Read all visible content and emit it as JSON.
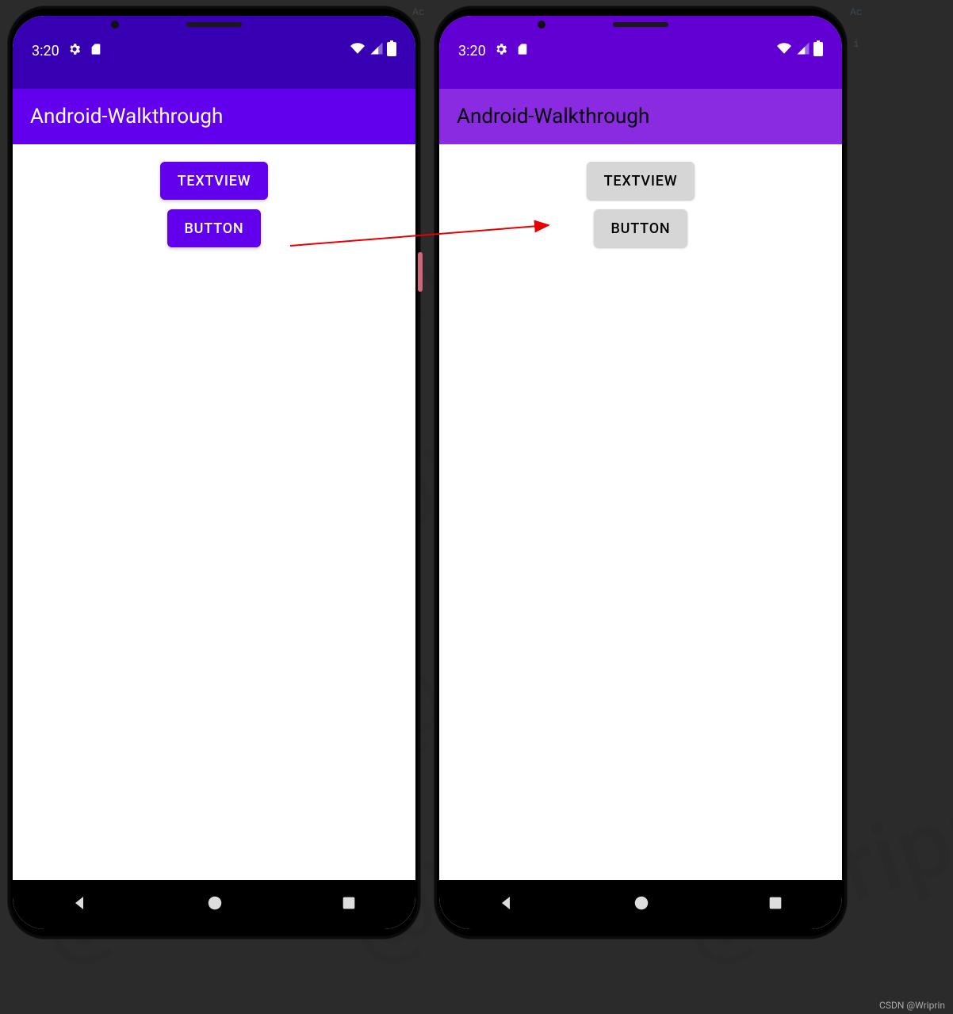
{
  "bg": {
    "snip1": "Ac",
    "snip2": "i"
  },
  "status": {
    "time": "3:20"
  },
  "header": {
    "title_left": "Android-Walkthrough",
    "title_right": "Android-Walkthrough"
  },
  "buttons": {
    "textview": "TEXTVIEW",
    "button": "BUTTON"
  },
  "watermark": "@Wriprin",
  "credit": "CSDN @Wriprin"
}
